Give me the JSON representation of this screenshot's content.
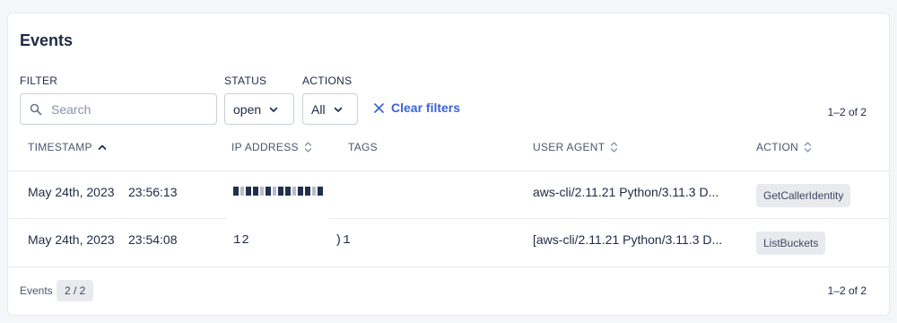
{
  "panel": {
    "title": "Events"
  },
  "filters": {
    "filter_label": "FILTER",
    "search_placeholder": "Search",
    "status_label": "STATUS",
    "status_value": "open",
    "actions_label": "ACTIONS",
    "actions_value": "All",
    "clear_label": "Clear filters",
    "range": "1–2 of 2"
  },
  "table": {
    "columns": {
      "timestamp": "TIMESTAMP",
      "ip": "IP ADDRESS",
      "tags": "TAGS",
      "user_agent": "USER AGENT",
      "action": "ACTION"
    },
    "sort": {
      "column": "timestamp",
      "direction": "ascending"
    },
    "rows": [
      {
        "date": "May 24th, 2023",
        "time": "23:56:13",
        "ip": "",
        "tags": "",
        "user_agent": "aws-cli/2.11.21 Python/3.11.3 D...",
        "action": "GetCallerIdentity"
      },
      {
        "date": "May 24th, 2023",
        "time": "23:54:08",
        "ip": "12          )1",
        "tags": "",
        "user_agent": "[aws-cli/2.11.21 Python/3.11.3 D...",
        "action": "ListBuckets"
      }
    ]
  },
  "footer": {
    "label": "Events",
    "badge": "2 / 2",
    "range": "1–2 of 2"
  },
  "colors": {
    "accent": "#3b63d6",
    "text": "#1f2a44",
    "muted": "#4a5670",
    "badge_bg": "#e8eaee"
  },
  "icons": {
    "search": "magnifier-icon",
    "select": "chevron-down-icon",
    "clear": "close-x-icon",
    "sort_active": "chevron-up-icon",
    "sort_inactive": "sort-updown-icon"
  }
}
